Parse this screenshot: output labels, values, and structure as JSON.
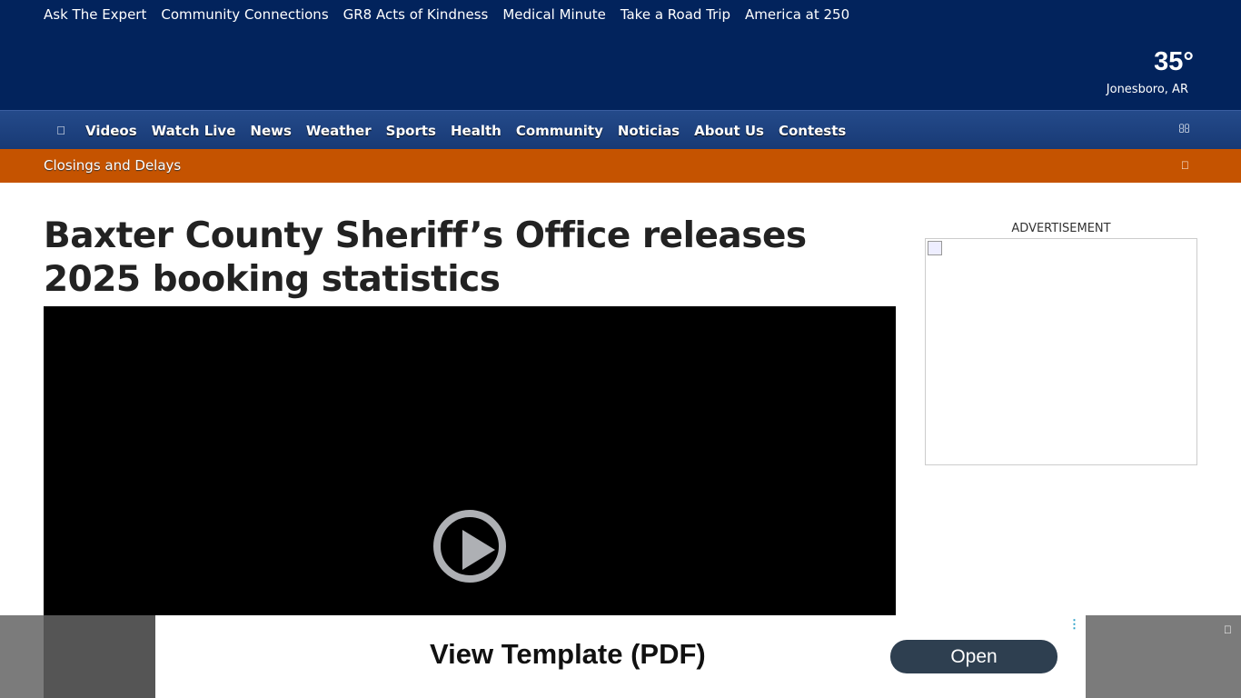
{
  "top_links": [
    "Ask The Expert",
    "Community Connections",
    "GR8 Acts of Kindness",
    "Medical Minute",
    "Take a Road Trip",
    "America at 250"
  ],
  "weather": {
    "temp": "35°",
    "location": "Jonesboro, AR"
  },
  "nav": {
    "home_icon": "",
    "items": [
      "Videos",
      "Watch Live",
      "News",
      "Weather",
      "Sports",
      "Health",
      "Community",
      "Noticias",
      "About Us",
      "Contests"
    ],
    "search_icon": ""
  },
  "alert": {
    "label": "Closings and Delays",
    "toggle_icon": ""
  },
  "article": {
    "headline": "Baxter County Sheriff’s Office releases 2025 booking statistics"
  },
  "sidebar": {
    "ad_label": "ADVERTISEMENT"
  },
  "overlay_ad": {
    "title": "View Template (PDF)",
    "button": "Open",
    "menu_icon": "⋮",
    "close_icon": ""
  }
}
